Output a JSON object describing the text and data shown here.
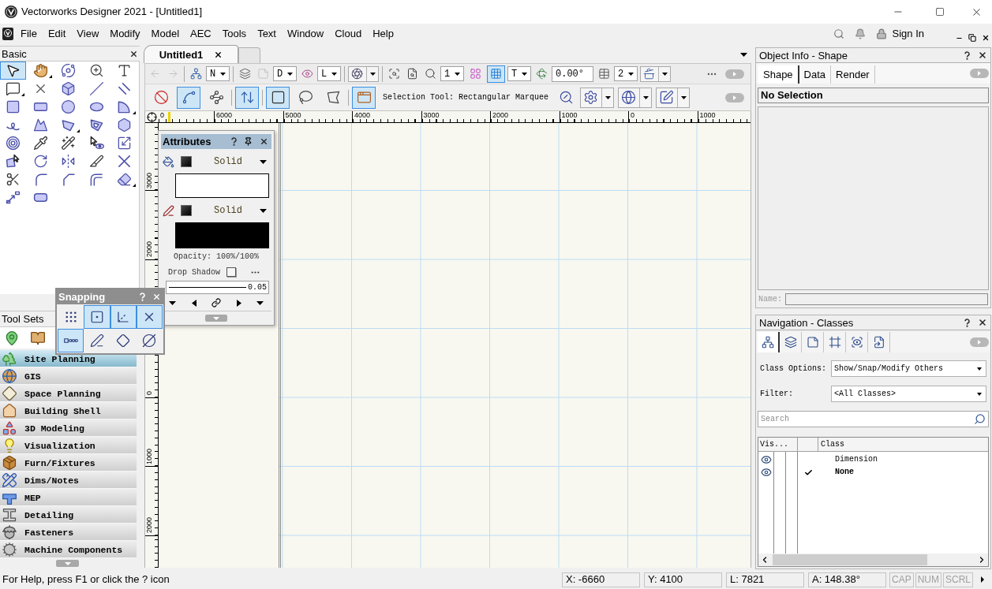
{
  "window": {
    "title": "Vectorworks Designer 2021 - [Untitled1]"
  },
  "menu_bar": {
    "items": [
      "File",
      "Edit",
      "View",
      "Modify",
      "Model",
      "AEC",
      "Tools",
      "Text",
      "Window",
      "Cloud",
      "Help"
    ],
    "sign_in": "Sign In"
  },
  "basic_palette": {
    "title": "Basic",
    "tools": [
      {
        "selected": true,
        "flyout": false
      },
      {
        "selected": false,
        "flyout": true
      },
      {
        "selected": false,
        "flyout": false
      },
      {
        "selected": false,
        "flyout": false
      },
      {
        "selected": false,
        "flyout": false
      },
      {
        "selected": false,
        "flyout": true
      },
      {
        "selected": false,
        "flyout": false
      },
      {
        "selected": false,
        "flyout": false
      },
      {
        "selected": false,
        "flyout": false
      },
      {
        "selected": false,
        "flyout": false
      },
      {
        "selected": false,
        "flyout": false
      },
      {
        "selected": false,
        "flyout": false
      },
      {
        "selected": false,
        "flyout": false
      },
      {
        "selected": false,
        "flyout": false
      },
      {
        "selected": false,
        "flyout": true
      },
      {
        "selected": false,
        "flyout": false
      },
      {
        "selected": false,
        "flyout": false
      },
      {
        "selected": false,
        "flyout": true
      },
      {
        "selected": false,
        "flyout": false
      },
      {
        "selected": false,
        "flyout": false
      },
      {
        "selected": false,
        "flyout": false
      },
      {
        "selected": false,
        "flyout": false
      },
      {
        "selected": false,
        "flyout": false
      },
      {
        "selected": false,
        "flyout": false
      },
      {
        "selected": false,
        "flyout": false
      },
      {
        "selected": false,
        "flyout": false
      },
      {
        "selected": false,
        "flyout": false
      },
      {
        "selected": false,
        "flyout": false
      },
      {
        "selected": false,
        "flyout": false
      },
      {
        "selected": false,
        "flyout": false
      },
      {
        "selected": false,
        "flyout": false
      },
      {
        "selected": false,
        "flyout": false
      },
      {
        "selected": false,
        "flyout": false
      },
      {
        "selected": false,
        "flyout": false
      },
      {
        "selected": false,
        "flyout": true
      },
      {
        "selected": false,
        "flyout": false
      },
      {
        "selected": false,
        "flyout": false
      }
    ]
  },
  "tool_sets": {
    "title": "Tool Sets",
    "tools": [
      {
        "selected": false
      },
      {
        "selected": false
      }
    ],
    "items": [
      {
        "label": "Site Planning",
        "selected": true
      },
      {
        "label": "GIS",
        "selected": false
      },
      {
        "label": "Space Planning",
        "selected": false
      },
      {
        "label": "Building Shell",
        "selected": false
      },
      {
        "label": "3D Modeling",
        "selected": false
      },
      {
        "label": "Visualization",
        "selected": false
      },
      {
        "label": "Furn/Fixtures",
        "selected": false
      },
      {
        "label": "Dims/Notes",
        "selected": false
      },
      {
        "label": "MEP",
        "selected": false
      },
      {
        "label": "Detailing",
        "selected": false
      },
      {
        "label": "Fasteners",
        "selected": false
      },
      {
        "label": "Machine Components",
        "selected": false
      }
    ]
  },
  "document_tabs": [
    {
      "label": "Untitled1",
      "selected": true
    }
  ],
  "view_bar": {
    "groups": [
      [
        {
          "kind": "button",
          "disabled": true
        },
        {
          "kind": "button",
          "disabled": true
        }
      ],
      [
        {
          "kind": "button",
          "disabled": false
        },
        {
          "kind": "dropdown",
          "value": "N"
        }
      ],
      [
        {
          "kind": "button",
          "disabled": false
        },
        {
          "kind": "button",
          "disabled": true
        },
        {
          "kind": "dropdown",
          "value": "D"
        },
        {
          "kind": "button",
          "disabled": false
        },
        {
          "kind": "dropdown",
          "value": "L"
        }
      ],
      [
        {
          "kind": "icon-dropdown"
        }
      ],
      [
        {
          "kind": "button",
          "disabled": false
        },
        {
          "kind": "button",
          "disabled": false
        },
        {
          "kind": "button",
          "disabled": false
        },
        {
          "kind": "dropdown",
          "value": "1"
        },
        {
          "kind": "toggle",
          "selected": false
        },
        {
          "kind": "toggle",
          "selected": true
        },
        {
          "kind": "dropdown",
          "value": "T"
        },
        {
          "kind": "button",
          "disabled": false
        },
        {
          "kind": "field",
          "value": "0.00°"
        },
        {
          "kind": "button",
          "disabled": false
        },
        {
          "kind": "dropdown",
          "value": "2"
        },
        {
          "kind": "icon-dropdown"
        }
      ]
    ]
  },
  "mode_bar": {
    "groups": [
      [
        {
          "kind": "toggle",
          "selected": false
        },
        {
          "kind": "toggle",
          "selected": true
        },
        {
          "kind": "toggle",
          "selected": false
        }
      ],
      [
        {
          "kind": "toggle",
          "selected": true
        }
      ],
      [
        {
          "kind": "toggle",
          "selected": true
        },
        {
          "kind": "toggle",
          "selected": false
        },
        {
          "kind": "toggle",
          "selected": false
        }
      ],
      [
        {
          "kind": "toggle",
          "selected": true
        },
        {
          "kind": "label",
          "label": "Selection Tool: Rectangular Marquee"
        },
        {
          "kind": "button",
          "disabled": false
        },
        {
          "kind": "icon-dropdown"
        },
        {
          "kind": "icon-dropdown"
        },
        {
          "kind": "icon-dropdown"
        }
      ]
    ]
  },
  "rulers": {
    "horizontal": [
      "0",
      "6000",
      "5000",
      "4000",
      "3000",
      "2000",
      "1000",
      "0",
      "1000"
    ],
    "vertical": {
      "upper": [
        "3000",
        "2000"
      ],
      "lower": [
        "0",
        "1000",
        "2000"
      ]
    }
  },
  "attributes_palette": {
    "title": "Attributes",
    "fill": {
      "style": "Solid"
    },
    "pen": {
      "style": "Solid"
    },
    "opacity": "Opacity: 100%/100%",
    "drop_shadow": {
      "label": "Drop Shadow",
      "checked": false
    },
    "line_weight": "0.05"
  },
  "snapping_palette": {
    "title": "Snapping",
    "buttons": [
      {
        "selected": false
      },
      {
        "selected": true
      },
      {
        "selected": true
      },
      {
        "selected": true
      },
      {
        "selected": true
      },
      {
        "selected": false
      },
      {
        "selected": false
      },
      {
        "selected": false
      }
    ]
  },
  "object_info": {
    "title": "Object Info - Shape",
    "tabs": [
      {
        "label": "Shape",
        "selected": true
      },
      {
        "label": "Data",
        "selected": false
      },
      {
        "label": "Render",
        "selected": false
      }
    ],
    "selection": "No Selection",
    "name_field": {
      "label": "Name:",
      "disabled": true
    }
  },
  "navigation": {
    "title": "Navigation - Classes",
    "tabs": [
      {
        "selected": true
      },
      {
        "selected": false
      },
      {
        "selected": false
      },
      {
        "selected": false
      },
      {
        "selected": false
      },
      {
        "selected": false
      }
    ],
    "class_options": {
      "label": "Class Options:",
      "value": "Show/Snap/Modify Others"
    },
    "filter": {
      "label": "Filter:",
      "value": "<All Classes>"
    },
    "search": {
      "placeholder": "Search"
    },
    "columns": [
      "Vis...",
      "Class"
    ],
    "rows": [
      {
        "name": "Dimension",
        "visible": true,
        "active": false
      },
      {
        "name": "None",
        "visible": true,
        "active": true
      }
    ]
  },
  "status_bar": {
    "help": "For Help, press F1 or click the ? icon",
    "readouts": [
      "X: -6660",
      "Y: 4100",
      "L: 7821",
      "A: 148.38°"
    ],
    "indicators": [
      {
        "label": "CAP",
        "on": false
      },
      {
        "label": "NUM",
        "on": false
      },
      {
        "label": "SCRL",
        "on": false
      }
    ]
  }
}
